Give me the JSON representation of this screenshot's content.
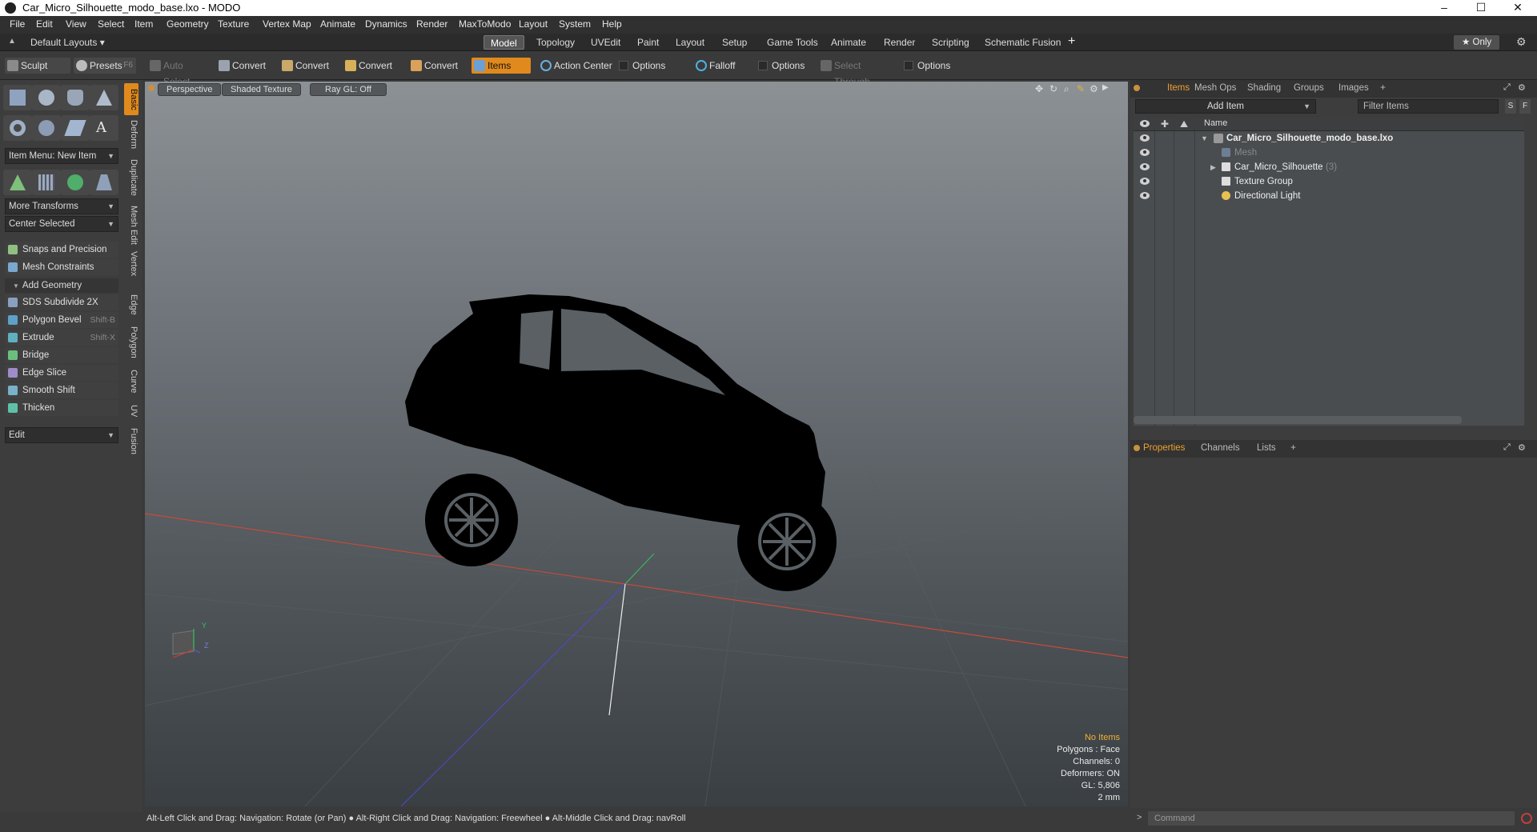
{
  "window": {
    "title": "Car_Micro_Silhouette_modo_base.lxo - MODO",
    "controls": [
      "–",
      "☐",
      "✕"
    ]
  },
  "menu": [
    "File",
    "Edit",
    "View",
    "Select",
    "Item",
    "Geometry",
    "Texture",
    "Vertex Map",
    "Animate",
    "Dynamics",
    "Render",
    "MaxToModo",
    "Layout",
    "System",
    "Help"
  ],
  "layoutbar": {
    "layouts_label": "Default Layouts ▾",
    "tabs": [
      "Model",
      "Topology",
      "UVEdit",
      "Paint",
      "Layout",
      "Setup",
      "Game Tools",
      "Animate",
      "Render",
      "Scripting",
      "Schematic Fusion"
    ],
    "active_tab": "Model",
    "add": "+",
    "only_label": "★  Only"
  },
  "toolbar": {
    "sculpt": "Sculpt",
    "presets": "Presets",
    "presets_key": "F6",
    "auto_select": "Auto Select",
    "convert1": "Convert",
    "convert2": "Convert",
    "convert3": "Convert",
    "convert4": "Convert",
    "items": "Items",
    "action_center": "Action Center",
    "options1": "Options",
    "falloff": "Falloff",
    "options2": "Options",
    "select_through": "Select Through",
    "options3": "Options"
  },
  "leftpanel": {
    "item_menu": "Item Menu: New Item",
    "more_transforms": "More Transforms",
    "center_selected": "Center Selected",
    "snaps": "Snaps and Precision",
    "mesh_constraints": "Mesh Constraints",
    "add_geometry": "Add Geometry",
    "tools": [
      {
        "label": "SDS Subdivide 2X",
        "shortcut": ""
      },
      {
        "label": "Polygon Bevel",
        "shortcut": "Shift-B"
      },
      {
        "label": "Extrude",
        "shortcut": "Shift-X"
      },
      {
        "label": "Bridge",
        "shortcut": ""
      },
      {
        "label": "Edge Slice",
        "shortcut": ""
      },
      {
        "label": "Smooth Shift",
        "shortcut": ""
      },
      {
        "label": "Thicken",
        "shortcut": ""
      }
    ],
    "edit": "Edit",
    "vtabs": [
      "Basic",
      "Deform",
      "Duplicate",
      "Mesh Edit",
      "Vertex",
      "Edge",
      "Polygon",
      "Curve",
      "UV",
      "Fusion"
    ]
  },
  "viewport": {
    "perspective": "Perspective",
    "shading": "Shaded Texture",
    "raygl": "Ray GL: Off",
    "stats": {
      "no_items": "No Items",
      "polygons": "Polygons : Face",
      "channels": "Channels: 0",
      "deformers": "Deformers: ON",
      "gl": "GL: 5,806",
      "scale": "2 mm"
    },
    "axis_y": "Y",
    "axis_z": "Z"
  },
  "statusbar": "Alt-Left Click and Drag: Navigation: Rotate (or Pan) ● Alt-Right Click and Drag: Navigation: Freewheel ● Alt-Middle Click and Drag: navRoll",
  "itemspanel": {
    "tabs": [
      "Items",
      "Mesh Ops",
      "Shading",
      "Groups",
      "Images"
    ],
    "add_item": "Add Item",
    "filter": "Filter Items",
    "s": "S",
    "f": "F",
    "name_header": "Name",
    "rows": [
      {
        "label": "Car_Micro_Silhouette_modo_base.lxo",
        "suffix": ""
      },
      {
        "label": "Mesh",
        "suffix": ""
      },
      {
        "label": "Car_Micro_Silhouette",
        "suffix": "(3)"
      },
      {
        "label": "Texture Group",
        "suffix": ""
      },
      {
        "label": "Directional Light",
        "suffix": ""
      }
    ]
  },
  "propspanel": {
    "tabs": [
      "Properties",
      "Channels",
      "Lists"
    ]
  },
  "command": {
    "placeholder": "Command"
  },
  "colors": {
    "accent": "#e08a1e",
    "active_tab_text": "#f0a030"
  }
}
